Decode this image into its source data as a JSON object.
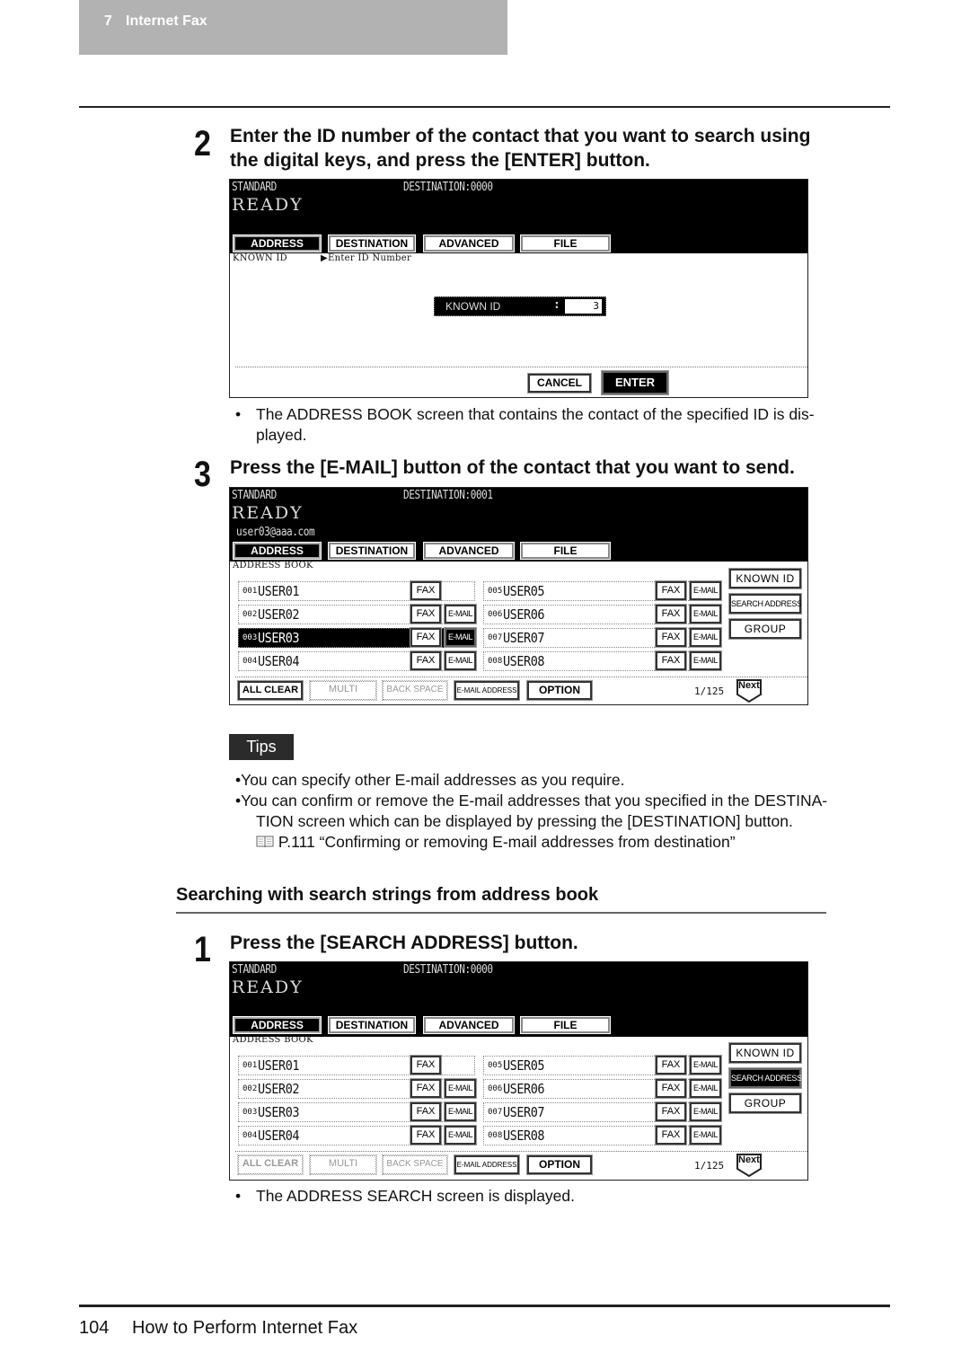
{
  "header": {
    "chapter_number": "7",
    "chapter_title": "Internet Fax"
  },
  "steps": {
    "step2": {
      "number": "2",
      "text_line1": "Enter the ID number of the contact that you want to search using",
      "text_line2": "the digital keys, and press the [ENTER] button."
    },
    "step2_note": {
      "bullet": "•",
      "line1": "The ADDRESS BOOK screen that contains the contact of the specified ID is dis-",
      "line2": "played."
    },
    "step3": {
      "number": "3",
      "text": "Press the [E-MAIL] button of the contact that you want to send."
    },
    "section_title": "Searching with search strings from address book",
    "step1": {
      "number": "1",
      "text": "Press the [SEARCH ADDRESS] button."
    },
    "step1_note": {
      "bullet": "•",
      "text": "The ADDRESS SEARCH screen is displayed."
    }
  },
  "tabs": [
    "ADDRESS",
    "DESTINATION",
    "ADVANCED",
    "FILE"
  ],
  "screen1": {
    "mode": "STANDARD",
    "destination": "DESTINATION:0000",
    "status": "READY",
    "sub_label": "KNOWN ID",
    "instruction": "▶Enter ID Number",
    "known_id_label": "KNOWN ID",
    "known_id_colon": ":",
    "known_id_value": "3",
    "cancel": "CANCEL",
    "enter": "ENTER"
  },
  "address_book_common": {
    "sub_label": "ADDRESS BOOK",
    "side_buttons": [
      "KNOWN ID",
      "SEARCH ADDRESS",
      "GROUP"
    ],
    "bottom_buttons": [
      "ALL CLEAR",
      "MULTI",
      "BACK SPACE",
      "E-MAIL ADDRESS",
      "OPTION"
    ],
    "fax": "FAX",
    "email": "E-MAIL",
    "page": "1/125",
    "next": "Next",
    "entries": [
      {
        "id": "001",
        "name": "USER01",
        "has_email": false
      },
      {
        "id": "002",
        "name": "USER02",
        "has_email": true
      },
      {
        "id": "003",
        "name": "USER03",
        "has_email": true
      },
      {
        "id": "004",
        "name": "USER04",
        "has_email": true
      },
      {
        "id": "005",
        "name": "USER05",
        "has_email": true
      },
      {
        "id": "006",
        "name": "USER06",
        "has_email": true
      },
      {
        "id": "007",
        "name": "USER07",
        "has_email": true
      },
      {
        "id": "008",
        "name": "USER08",
        "has_email": true
      }
    ]
  },
  "screen2": {
    "mode": "STANDARD",
    "destination": "DESTINATION:0001",
    "status": "READY",
    "email_line": "user03@aaa.com",
    "selected_entry": "003",
    "active_side_button": "",
    "disabled_bottom_buttons": [
      "MULTI",
      "BACK SPACE"
    ]
  },
  "screen3": {
    "mode": "STANDARD",
    "destination": "DESTINATION:0000",
    "status": "READY",
    "email_line": "",
    "selected_entry": "",
    "active_side_button": "SEARCH ADDRESS",
    "disabled_bottom_buttons": [
      "ALL CLEAR",
      "MULTI",
      "BACK SPACE"
    ]
  },
  "tips": {
    "badge": "Tips",
    "item1": "•You can specify other E-mail addresses as you require.",
    "item2_line1": "•You can confirm or remove the E-mail addresses that you specified in the DESTINA-",
    "item2_line2": "TION screen which can be displayed by pressing the [DESTINATION] button.",
    "reference_icon": "book-icon",
    "reference": "P.111 “Confirming or removing E-mail addresses from destination”"
  },
  "footer": {
    "page_number": "104",
    "title": "How to Perform Internet Fax"
  }
}
